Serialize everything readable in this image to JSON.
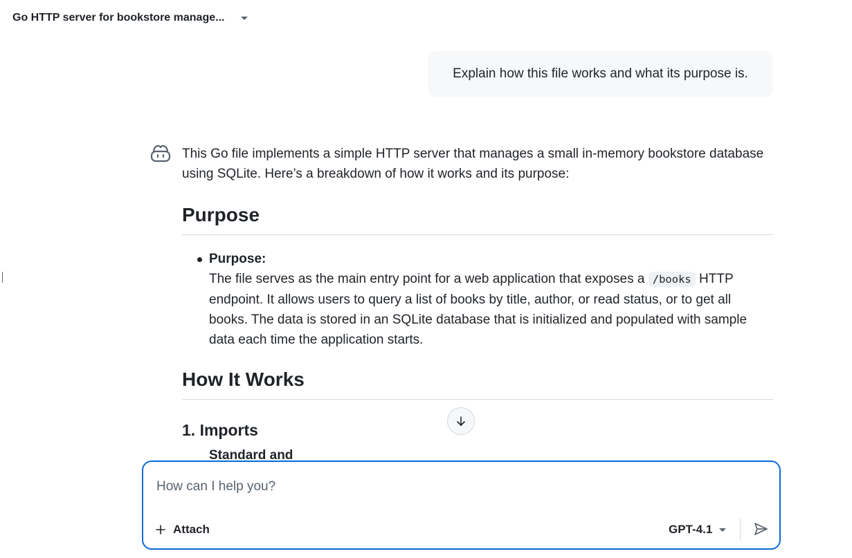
{
  "header": {
    "title": "Go HTTP server for bookstore manage...",
    "icon": "chevron-down-icon"
  },
  "user_message": {
    "text": "Explain how this file works and what its purpose is."
  },
  "assistant": {
    "avatar_icon": "copilot-icon",
    "intro": "This Go file implements a simple HTTP server that manages a small in-memory bookstore database using SQLite. Here’s a breakdown of how it works and its purpose:",
    "purpose_heading": "Purpose",
    "purpose_bullet": {
      "label": "Purpose:",
      "text_before_code": "The file serves as the main entry point for a web application that exposes a ",
      "code": "/books",
      "text_after_code": " HTTP endpoint. It allows users to query a list of books by title, author, or read status, or to get all books. The data is stored in an SQLite database that is initialized and populated with sample data each time the application starts."
    },
    "how_heading": "How It Works",
    "imports_heading": "1. Imports",
    "partial_next": "Standard and"
  },
  "scroll_button": {
    "icon": "arrow-down-icon"
  },
  "composer": {
    "placeholder": "How can I help you?",
    "value": "",
    "attach_label": "Attach",
    "attach_icon": "plus-icon",
    "model_label": "GPT-4.1",
    "model_icon": "chevron-down-icon",
    "send_icon": "send-icon"
  },
  "colors": {
    "accent": "#0969da",
    "bubble_bg": "#f6f8fa",
    "text": "#1f2328",
    "muted": "#59636e",
    "border": "#d1d9e0"
  }
}
